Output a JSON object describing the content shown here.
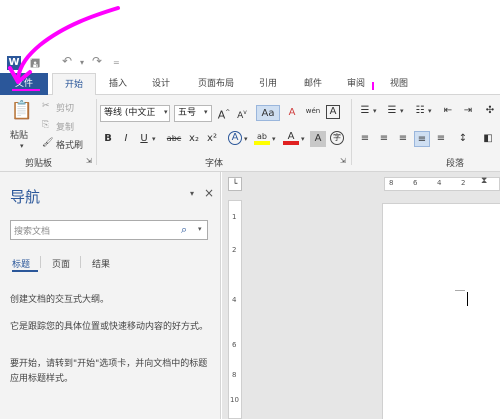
{
  "qat": {
    "word_logo": "W",
    "save_icon": "save-icon",
    "undo_icon": "undo-icon",
    "redo_icon": "redo-icon",
    "customize_icon": "customize-icon"
  },
  "tabs": [
    "文件",
    "开始",
    "插入",
    "设计",
    "页面布局",
    "引用",
    "邮件",
    "审阅",
    "视图"
  ],
  "clipboard": {
    "paste": "粘贴",
    "cut": "剪切",
    "copy": "复制",
    "format_painter": "格式刷",
    "label": "剪贴板"
  },
  "font": {
    "font_name": "等线 (中文正",
    "font_size": "五号",
    "label": "字体",
    "bold": "B",
    "italic": "I",
    "underline": "U",
    "strike": "abc",
    "subscript": "x₂",
    "superscript": "x²",
    "grow": "A",
    "shrink": "A",
    "case": "Aa",
    "clear": "A",
    "phonetic": "wén",
    "border": "A",
    "effects": "A",
    "highlight": "ab",
    "color": "A",
    "shade": "A",
    "circle": "字"
  },
  "paragraph": {
    "label": "段落"
  },
  "nav": {
    "title": "导航",
    "search_placeholder": "搜索文档",
    "tabs": [
      "标题",
      "页面",
      "结果"
    ],
    "text1": "创建文档的交互式大纲。",
    "text2": "它是跟踪您的具体位置或快速移动内容的好方式。",
    "text3": "要开始，请转到\"开始\"选项卡，并向文档中的标题应用标题样式。"
  },
  "ruler": {
    "h_numbers": [
      "8",
      "6",
      "4",
      "2"
    ],
    "v_numbers": [
      "1",
      "2",
      "4",
      "6",
      "8",
      "10"
    ]
  },
  "colors": {
    "word_blue": "#2b579a",
    "highlight_yellow": "#ffff00",
    "font_red": "#e02020",
    "annotation_magenta": "#ff00ff"
  }
}
